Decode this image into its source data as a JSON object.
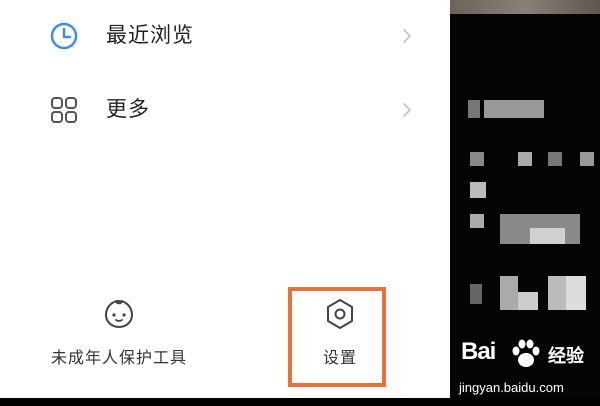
{
  "menu": {
    "items": [
      {
        "label": "最近浏览",
        "icon": "clock-icon"
      },
      {
        "label": "更多",
        "icon": "grid-icon"
      }
    ]
  },
  "bottom_bar": {
    "youth_label": "未成年人保护工具",
    "settings_label": "设置"
  },
  "watermark": {
    "brand": "Bai  经验",
    "logo_text": "Bai",
    "logo_suffix": "经验",
    "url": "jingyan.baidu.com"
  },
  "colors": {
    "highlight": "#e8703b",
    "clock_icon": "#3b8ee8",
    "text": "#222222"
  }
}
